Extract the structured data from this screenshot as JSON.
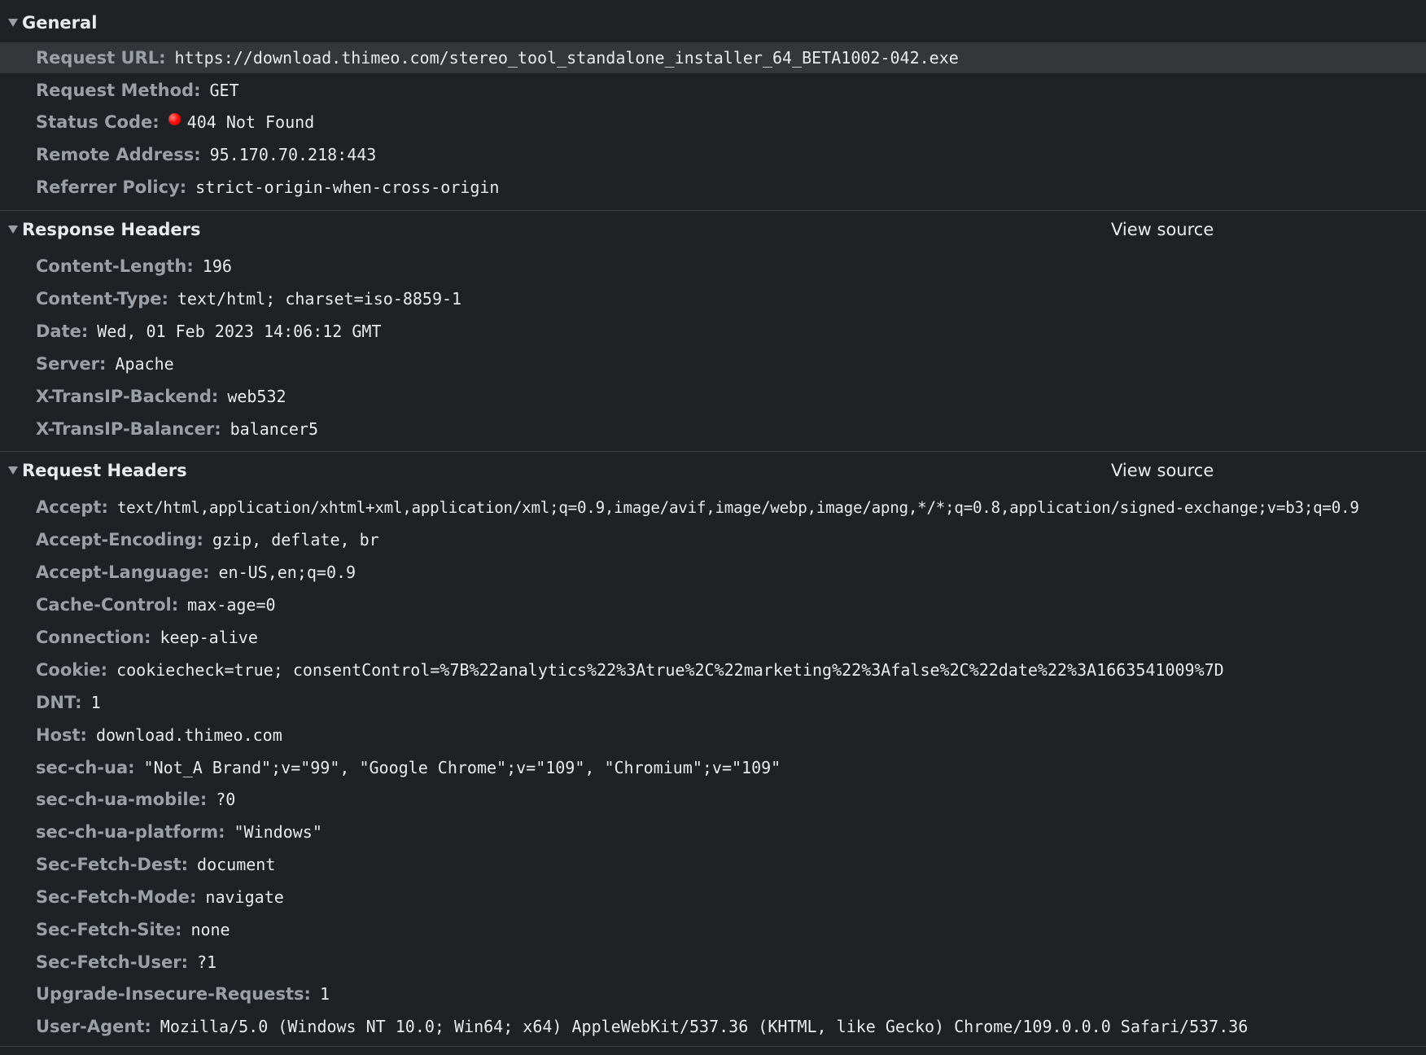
{
  "general": {
    "title": "General",
    "rows": [
      {
        "key": "Request URL:",
        "value": "https://download.thimeo.com/stereo_tool_standalone_installer_64_BETA1002-042.exe"
      },
      {
        "key": "Request Method:",
        "value": "GET"
      },
      {
        "key": "Status Code:",
        "value": "404 Not Found",
        "status_color": "#ff1a1a"
      },
      {
        "key": "Remote Address:",
        "value": "95.170.70.218:443"
      },
      {
        "key": "Referrer Policy:",
        "value": "strict-origin-when-cross-origin"
      }
    ]
  },
  "response_headers": {
    "title": "Response Headers",
    "view_source": "View source",
    "rows": [
      {
        "key": "Content-Length:",
        "value": "196"
      },
      {
        "key": "Content-Type:",
        "value": "text/html; charset=iso-8859-1"
      },
      {
        "key": "Date:",
        "value": "Wed, 01 Feb 2023 14:06:12 GMT"
      },
      {
        "key": "Server:",
        "value": "Apache"
      },
      {
        "key": "X-TransIP-Backend:",
        "value": "web532"
      },
      {
        "key": "X-TransIP-Balancer:",
        "value": "balancer5"
      }
    ]
  },
  "request_headers": {
    "title": "Request Headers",
    "view_source": "View source",
    "rows": [
      {
        "key": "Accept:",
        "value": "text/html,application/xhtml+xml,application/xml;q=0.9,image/avif,image/webp,image/apng,*/*;q=0.8,application/signed-exchange;v=b3;q=0.9"
      },
      {
        "key": "Accept-Encoding:",
        "value": "gzip, deflate, br"
      },
      {
        "key": "Accept-Language:",
        "value": "en-US,en;q=0.9"
      },
      {
        "key": "Cache-Control:",
        "value": "max-age=0"
      },
      {
        "key": "Connection:",
        "value": "keep-alive"
      },
      {
        "key": "Cookie:",
        "value": "cookiecheck=true; consentControl=%7B%22analytics%22%3Atrue%2C%22marketing%22%3Afalse%2C%22date%22%3A1663541009%7D"
      },
      {
        "key": "DNT:",
        "value": "1"
      },
      {
        "key": "Host:",
        "value": "download.thimeo.com"
      },
      {
        "key": "sec-ch-ua:",
        "value": "\"Not_A Brand\";v=\"99\", \"Google Chrome\";v=\"109\", \"Chromium\";v=\"109\""
      },
      {
        "key": "sec-ch-ua-mobile:",
        "value": "?0"
      },
      {
        "key": "sec-ch-ua-platform:",
        "value": "\"Windows\""
      },
      {
        "key": "Sec-Fetch-Dest:",
        "value": "document"
      },
      {
        "key": "Sec-Fetch-Mode:",
        "value": "navigate"
      },
      {
        "key": "Sec-Fetch-Site:",
        "value": "none"
      },
      {
        "key": "Sec-Fetch-User:",
        "value": "?1"
      },
      {
        "key": "Upgrade-Insecure-Requests:",
        "value": "1"
      },
      {
        "key": "User-Agent:",
        "value": "Mozilla/5.0 (Windows NT 10.0; Win64; x64) AppleWebKit/537.36 (KHTML, like Gecko) Chrome/109.0.0.0 Safari/537.36"
      }
    ]
  },
  "icons": {
    "collapse": "triangle-down-icon",
    "status": "red-dot-icon"
  },
  "colors": {
    "background": "#202124",
    "highlight_row": "#35363a",
    "key_text": "#9aa0a6",
    "value_text": "#e8eaed",
    "separator": "#3c4043"
  }
}
